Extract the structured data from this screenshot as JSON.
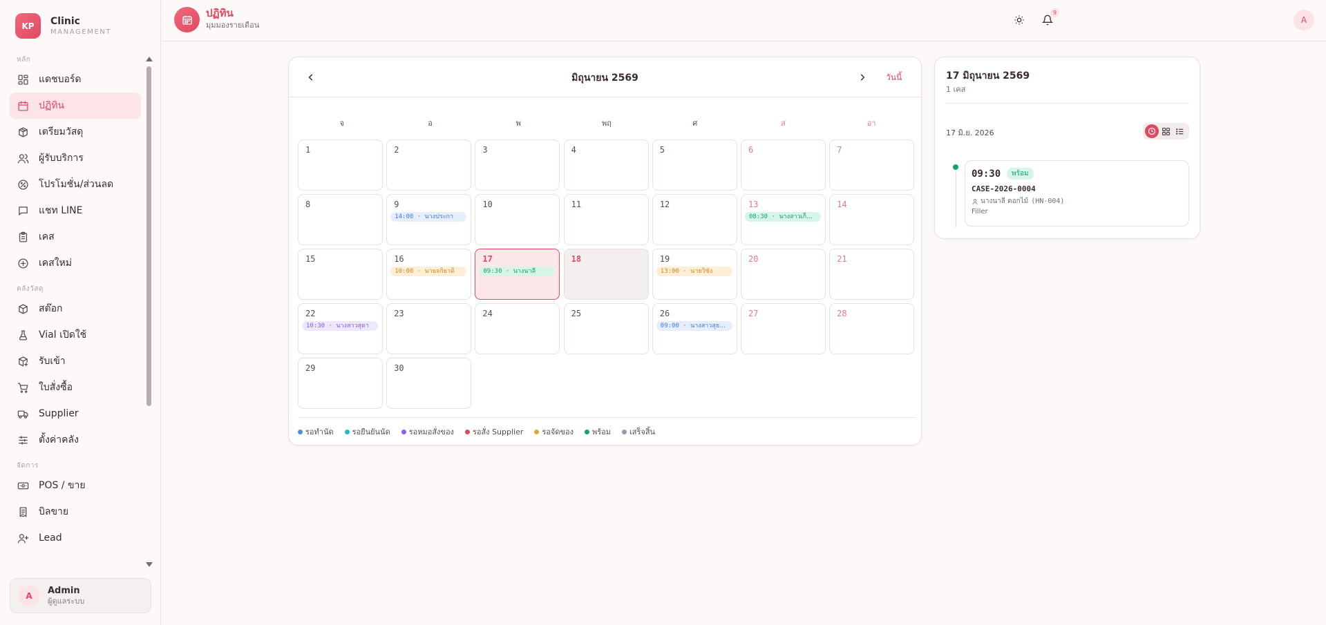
{
  "brand": {
    "logo": "KP",
    "name": "Clinic",
    "sub": "MANAGEMENT"
  },
  "sidebar": {
    "sections": [
      {
        "title": "หลัก",
        "items": [
          {
            "label": "แดชบอร์ด",
            "icon": "dashboard-icon"
          },
          {
            "label": "ปฏิทิน",
            "icon": "calendar-icon",
            "active": true
          },
          {
            "label": "เตรียมวัสดุ",
            "icon": "package-icon"
          },
          {
            "label": "ผู้รับบริการ",
            "icon": "users-icon"
          },
          {
            "label": "โปรโมชั่น/ส่วนลด",
            "icon": "percent-icon"
          },
          {
            "label": "แชท LINE",
            "icon": "chat-icon"
          },
          {
            "label": "เคส",
            "icon": "clipboard-icon"
          },
          {
            "label": "เคสใหม่",
            "icon": "plus-circle-icon"
          }
        ]
      },
      {
        "title": "คลังวัสดุ",
        "items": [
          {
            "label": "สต๊อก",
            "icon": "box-icon"
          },
          {
            "label": "Vial เปิดใช้",
            "icon": "flask-icon"
          },
          {
            "label": "รับเข้า",
            "icon": "package-in-icon"
          },
          {
            "label": "ใบสั่งซื้อ",
            "icon": "cart-icon"
          },
          {
            "label": "Supplier",
            "icon": "truck-icon"
          },
          {
            "label": "ตั้งค่าคลัง",
            "icon": "sliders-icon"
          }
        ]
      },
      {
        "title": "จัดการ",
        "items": [
          {
            "label": "POS / ขาย",
            "icon": "cash-icon"
          },
          {
            "label": "บิลขาย",
            "icon": "receipt-icon"
          },
          {
            "label": "Lead",
            "icon": "user-plus-icon"
          }
        ]
      }
    ]
  },
  "user": {
    "initial": "A",
    "name": "Admin",
    "role": "ผู้ดูแลระบบ"
  },
  "header": {
    "title": "ปฏิทิน",
    "subtitle": "มุมมองรายเดือน",
    "notif_count": "9",
    "avatar": "A"
  },
  "calendar": {
    "month_title": "มิถุนายน 2569",
    "today_label": "วันนี้",
    "weekdays": [
      "จ",
      "อ",
      "พ",
      "พฤ",
      "ศ",
      "ส",
      "อา"
    ],
    "days": [
      {
        "d": "1"
      },
      {
        "d": "2"
      },
      {
        "d": "3"
      },
      {
        "d": "4"
      },
      {
        "d": "5"
      },
      {
        "d": "6"
      },
      {
        "d": "7"
      },
      {
        "d": "8"
      },
      {
        "d": "9",
        "event": {
          "time": "14:00",
          "name": "นางประกา",
          "color": "#3b7de0",
          "bg": "#e6eefb"
        }
      },
      {
        "d": "10"
      },
      {
        "d": "11"
      },
      {
        "d": "12"
      },
      {
        "d": "13",
        "event": {
          "time": "08:30",
          "name": "นางสาวเก็...",
          "color": "#16a36b",
          "bg": "#d6f5e6"
        }
      },
      {
        "d": "14"
      },
      {
        "d": "15"
      },
      {
        "d": "16",
        "event": {
          "time": "10:00",
          "name": "นายจกิยาดิ",
          "color": "#d48a1a",
          "bg": "#fdeed6"
        }
      },
      {
        "d": "17",
        "today": true,
        "event": {
          "time": "09:30",
          "name": "นางนาลี",
          "color": "#16a36b",
          "bg": "#d6f5e6"
        }
      },
      {
        "d": "18",
        "selected": true
      },
      {
        "d": "19",
        "event": {
          "time": "13:00",
          "name": "นายวิชัง",
          "color": "#d48a1a",
          "bg": "#fdeed6"
        }
      },
      {
        "d": "20"
      },
      {
        "d": "21"
      },
      {
        "d": "22",
        "event": {
          "time": "10:30",
          "name": "นางสาวสุดา",
          "color": "#8b5cf6",
          "bg": "#eee8fd"
        }
      },
      {
        "d": "23"
      },
      {
        "d": "24"
      },
      {
        "d": "25"
      },
      {
        "d": "26",
        "event": {
          "time": "09:00",
          "name": "นางสาวสุธ...",
          "color": "#3b7de0",
          "bg": "#e6eefb"
        }
      },
      {
        "d": "27"
      },
      {
        "d": "28"
      },
      {
        "d": "29"
      },
      {
        "d": "30"
      }
    ],
    "legend": [
      {
        "label": "รอทำนัด",
        "color": "#4a8ee6"
      },
      {
        "label": "รอยืนยันนัด",
        "color": "#22b8c8"
      },
      {
        "label": "รอหมอสั่งของ",
        "color": "#8b5cf6"
      },
      {
        "label": "รอสั่ง Supplier",
        "color": "#e04a5f"
      },
      {
        "label": "รอจัดของ",
        "color": "#e8a33a"
      },
      {
        "label": "พร้อม",
        "color": "#16a36b"
      },
      {
        "label": "เสร็จสิ้น",
        "color": "#9a98b0"
      }
    ]
  },
  "day_panel": {
    "title": "17 มิถุนายน 2569",
    "count": "1 เคส",
    "date_label": "17 มิ.ย. 2026",
    "appointment": {
      "time": "09:30",
      "status": "พร้อม",
      "case_id": "CASE-2026-0004",
      "patient": "นางนาลี ดอกไม้",
      "hn": "(HN-004)",
      "type": "Filler"
    }
  }
}
